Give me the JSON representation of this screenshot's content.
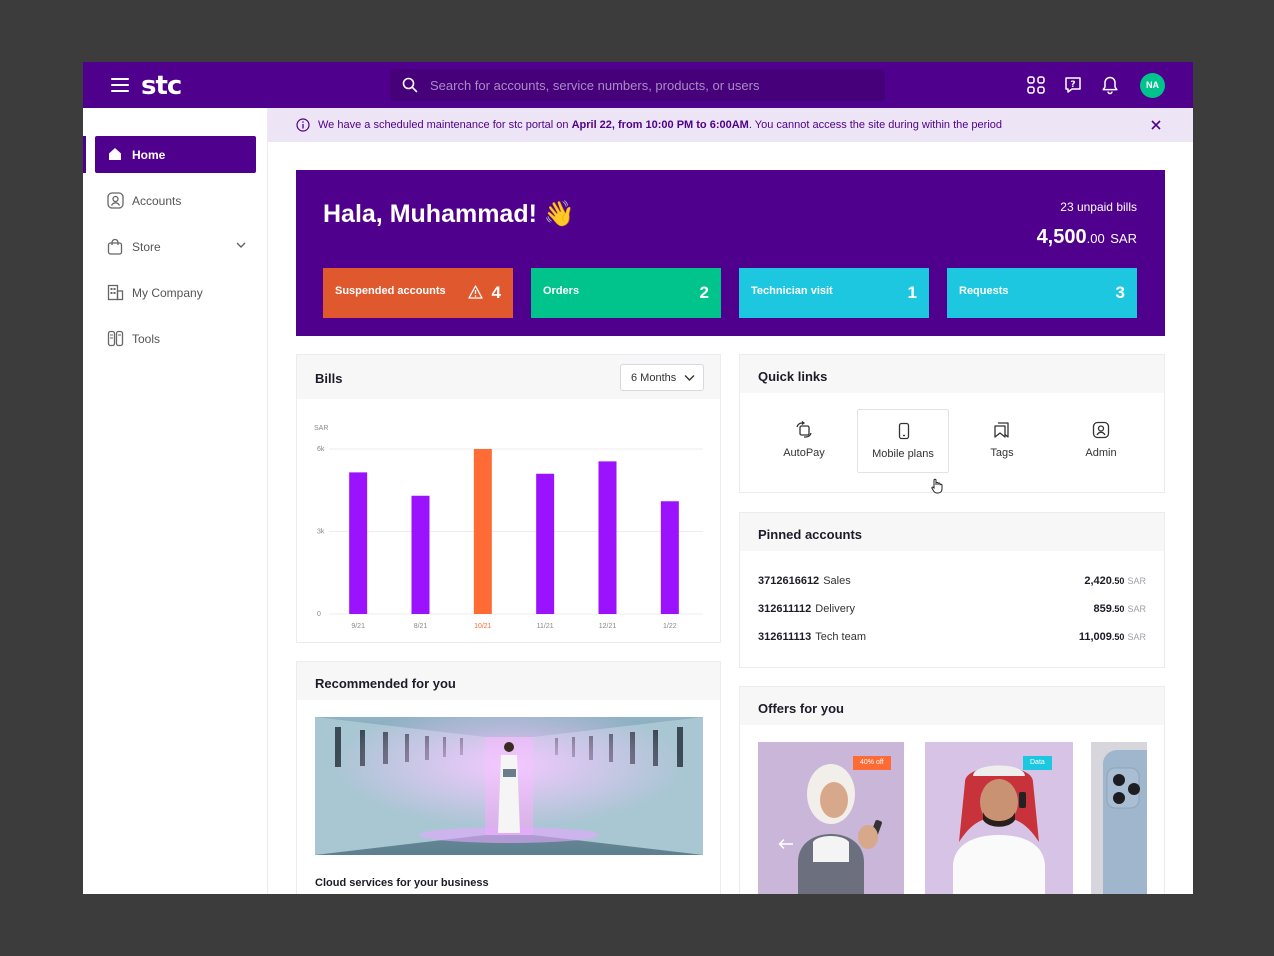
{
  "app": {
    "logo": "stc",
    "search_placeholder": "Search for accounts, service numbers, products, or users",
    "avatar_initials": "NA"
  },
  "colors": {
    "brand": "#4f008c",
    "suspended": "#e0582e",
    "orders": "#00c48c",
    "technician": "#1ec7e0",
    "requests": "#1ec7e0",
    "bar": "#9b12ff",
    "bar_highlight": "#ff6b35"
  },
  "sidebar": {
    "items": [
      {
        "label": "Home",
        "icon": "home-icon"
      },
      {
        "label": "Accounts",
        "icon": "user-icon"
      },
      {
        "label": "Store",
        "icon": "bag-icon"
      },
      {
        "label": "My Company",
        "icon": "building-icon"
      },
      {
        "label": "Tools",
        "icon": "tools-icon"
      }
    ]
  },
  "banner": {
    "prefix": "We have a scheduled maintenance for stc portal on ",
    "highlight": "April 22, from 10:00 PM to 6:00AM",
    "suffix": ". You cannot access the site during within the period"
  },
  "hero": {
    "greeting": "Hala, Muhammad! 👋",
    "unpaid_label": "23 unpaid bills",
    "amount_main": "4,500",
    "amount_dec": ".00",
    "amount_currency": "SAR",
    "stats": [
      {
        "label": "Suspended accounts",
        "value": "4"
      },
      {
        "label": "Orders",
        "value": "2"
      },
      {
        "label": "Technician visit",
        "value": "1"
      },
      {
        "label": "Requests",
        "value": "3"
      }
    ]
  },
  "bills": {
    "title": "Bills",
    "period": "6 Months"
  },
  "chart_data": {
    "type": "bar",
    "ylabel": "SAR",
    "ylim": [
      0,
      6000
    ],
    "yticks": [
      "0",
      "3k",
      "6k"
    ],
    "categories": [
      "9/21",
      "8/21",
      "10/21",
      "11/21",
      "12/21",
      "1/22"
    ],
    "values": [
      5150,
      4300,
      6000,
      5100,
      5550,
      4100
    ],
    "highlight_index": 2,
    "grid": true
  },
  "quick_links": {
    "title": "Quick links",
    "items": [
      {
        "label": "AutoPay",
        "icon": "autopay-icon"
      },
      {
        "label": "Mobile plans",
        "icon": "mobile-icon"
      },
      {
        "label": "Tags",
        "icon": "tags-icon"
      },
      {
        "label": "Admin",
        "icon": "admin-icon"
      }
    ]
  },
  "pinned": {
    "title": "Pinned accounts",
    "currency": "SAR",
    "rows": [
      {
        "number": "3712616612",
        "name": "Sales",
        "amount": "2,420",
        "dec": ".50"
      },
      {
        "number": "312611112",
        "name": "Delivery",
        "amount": "859",
        "dec": ".50"
      },
      {
        "number": "312611113",
        "name": "Tech team",
        "amount": "11,009",
        "dec": ".50"
      }
    ]
  },
  "recommended": {
    "title": "Recommended for you",
    "caption": "Cloud services for your business"
  },
  "offers": {
    "title": "Offers for you",
    "items": [
      {
        "badge": "40% off"
      },
      {
        "badge": "Data"
      }
    ]
  }
}
